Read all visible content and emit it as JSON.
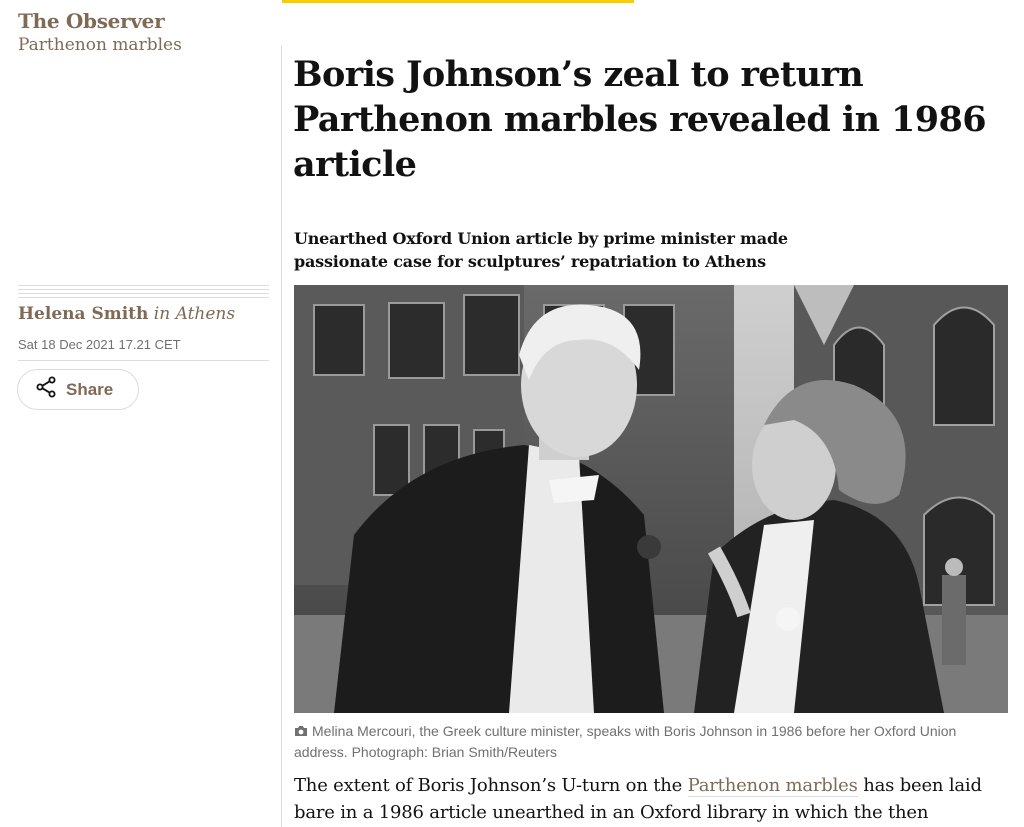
{
  "series": {
    "name": "The Observer",
    "topic": "Parthenon marbles"
  },
  "byline": {
    "author": "Helena Smith",
    "location": "in Athens"
  },
  "dateline": "Sat 18 Dec 2021 17.21 CET",
  "share": {
    "label": "Share",
    "icon": "share-icon"
  },
  "headline": "Boris Johnson’s zeal to return Parthenon marbles revealed in 1986 article",
  "standfirst": "Unearthed Oxford Union article by prime minister made passionate case for sculptures’ repatriation to Athens",
  "caption": {
    "icon": "camera-icon",
    "text": "Melina Mercouri, the Greek culture minister, speaks with Boris Johnson in 1986 before her Oxford Union address. Photograph: Brian Smith/Reuters"
  },
  "body": {
    "before_link": "The extent of Boris Johnson’s U-turn on the ",
    "link_text": "Parthenon marbles",
    "after_link": " has been laid bare in a 1986 article unearthed in an Oxford library in which the then"
  },
  "colors": {
    "accent": "#f5d000",
    "brand_brown": "#7f6a55",
    "text": "#121212",
    "muted": "#707070",
    "rule": "#dcdcdc"
  }
}
